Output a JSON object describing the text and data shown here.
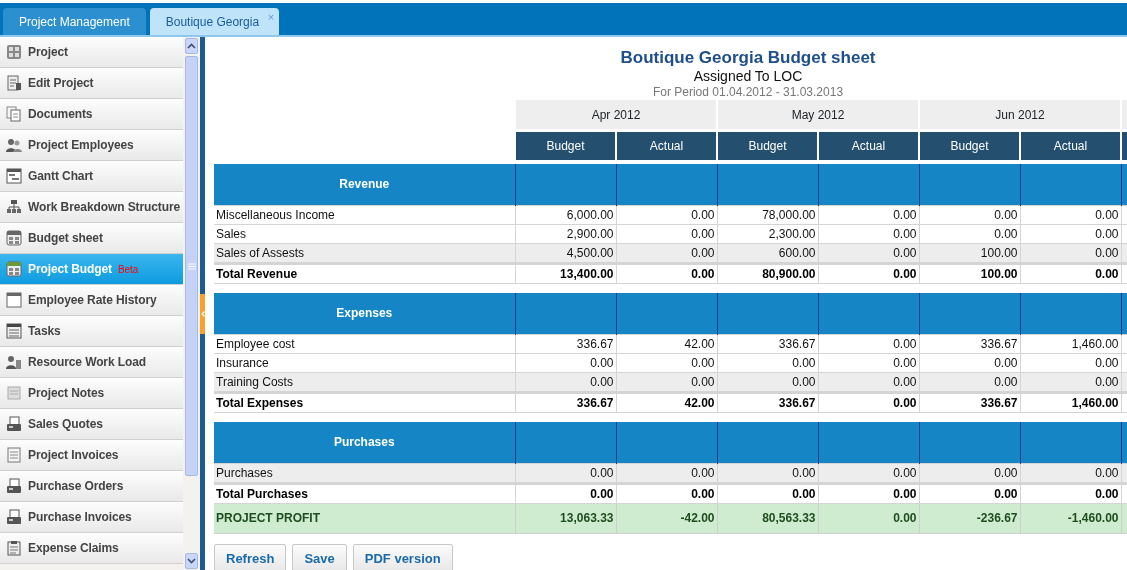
{
  "tabs": [
    {
      "label": "Project Management",
      "selected": false
    },
    {
      "label": "Boutique Georgia",
      "selected": true,
      "close": "×"
    }
  ],
  "sidebar": {
    "items": [
      {
        "label": "Project",
        "selected": false
      },
      {
        "label": "Edit Project",
        "selected": false
      },
      {
        "label": "Documents",
        "selected": false
      },
      {
        "label": "Project Employees",
        "selected": false
      },
      {
        "label": "Gantt Chart",
        "selected": false
      },
      {
        "label": "Work Breakdown Structure",
        "selected": false
      },
      {
        "label": "Budget sheet",
        "selected": false
      },
      {
        "label": "Project Budget",
        "selected": true,
        "badge": "Beta"
      },
      {
        "label": "Employee Rate History",
        "selected": false
      },
      {
        "label": "Tasks",
        "selected": false
      },
      {
        "label": "Resource Work Load",
        "selected": false
      },
      {
        "label": "Project Notes",
        "selected": false
      },
      {
        "label": "Sales Quotes",
        "selected": false
      },
      {
        "label": "Project Invoices",
        "selected": false
      },
      {
        "label": "Purchase Orders",
        "selected": false
      },
      {
        "label": "Purchase Invoices",
        "selected": false
      },
      {
        "label": "Expense Claims",
        "selected": false
      }
    ]
  },
  "report": {
    "title": "Boutique Georgia Budget sheet",
    "subtitle": "Assigned To LOC",
    "period": "For Period 01.04.2012 - 31.03.2013"
  },
  "table": {
    "months": [
      {
        "label": "Apr 2012",
        "columns": [
          "Budget",
          "Actual"
        ]
      },
      {
        "label": "May 2012",
        "columns": [
          "Budget",
          "Actual"
        ]
      },
      {
        "label": "Jun 2012",
        "columns": [
          "Budget",
          "Actual"
        ]
      }
    ],
    "sections": [
      {
        "title": "Revenue",
        "rows": [
          {
            "label": "Miscellaneous Income",
            "values": [
              "6,000.00",
              "0.00",
              "78,000.00",
              "0.00",
              "0.00",
              "0.00"
            ]
          },
          {
            "label": "Sales",
            "values": [
              "2,900.00",
              "0.00",
              "2,300.00",
              "0.00",
              "0.00",
              "0.00"
            ]
          },
          {
            "label": "Sales of Assests",
            "values": [
              "4,500.00",
              "0.00",
              "600.00",
              "0.00",
              "100.00",
              "0.00"
            ]
          }
        ],
        "total": {
          "label": "Total Revenue",
          "values": [
            "13,400.00",
            "0.00",
            "80,900.00",
            "0.00",
            "100.00",
            "0.00"
          ]
        }
      },
      {
        "title": "Expenses",
        "rows": [
          {
            "label": "Employee cost",
            "values": [
              "336.67",
              "42.00",
              "336.67",
              "0.00",
              "336.67",
              "1,460.00"
            ]
          },
          {
            "label": "Insurance",
            "values": [
              "0.00",
              "0.00",
              "0.00",
              "0.00",
              "0.00",
              "0.00"
            ]
          },
          {
            "label": "Training Costs",
            "values": [
              "0.00",
              "0.00",
              "0.00",
              "0.00",
              "0.00",
              "0.00"
            ]
          }
        ],
        "total": {
          "label": "Total Expenses",
          "values": [
            "336.67",
            "42.00",
            "336.67",
            "0.00",
            "336.67",
            "1,460.00"
          ]
        }
      },
      {
        "title": "Purchases",
        "rows": [
          {
            "label": "Purchases",
            "values": [
              "0.00",
              "0.00",
              "0.00",
              "0.00",
              "0.00",
              "0.00"
            ]
          }
        ],
        "total": {
          "label": "Total Purchases",
          "values": [
            "0.00",
            "0.00",
            "0.00",
            "0.00",
            "0.00",
            "0.00"
          ]
        }
      }
    ],
    "profit": {
      "label": "PROJECT PROFIT",
      "values": [
        "13,063.33",
        "-42.00",
        "80,563.33",
        "0.00",
        "-236.67",
        "-1,460.00"
      ]
    }
  },
  "buttons": [
    "Refresh",
    "Save",
    "PDF version"
  ]
}
